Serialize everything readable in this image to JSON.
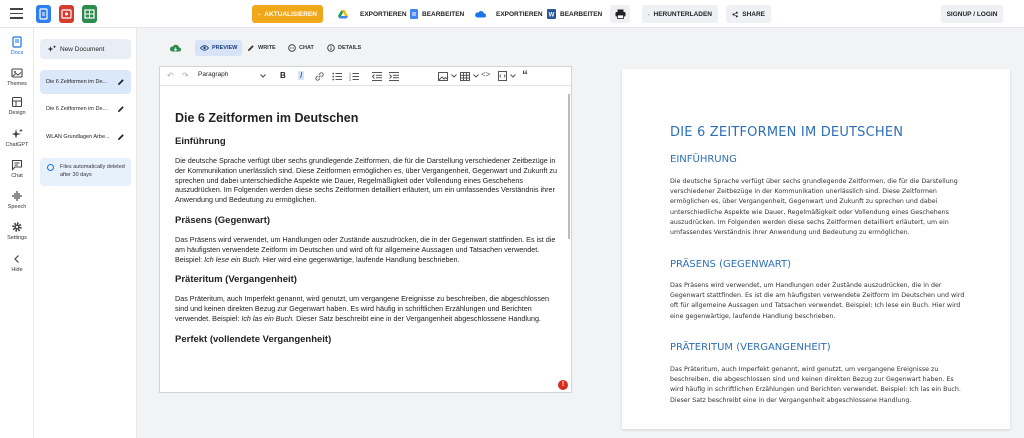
{
  "topbar": {
    "aktualisieren": "AKTUALISIEREN",
    "exportieren1": "EXPORTIEREN",
    "bearbeiten1": "BEARBEITEN",
    "exportieren2": "EXPORTIEREN",
    "bearbeiten2": "BEARBEITEN",
    "herunterladen": "HERUNTERLADEN",
    "share": "SHARE",
    "signup": "SIGNUP / LOGIN"
  },
  "rail": {
    "docs": "Docs",
    "themes": "Themes",
    "design": "Design",
    "chatgpt": "ChatGPT",
    "chat": "Chat",
    "speech": "Speech",
    "settings": "Settings",
    "hide": "Hide"
  },
  "docs_panel": {
    "new_doc": "New Document",
    "items": [
      "Die 6 Zeitformen im De...",
      "Die 6 Zeitformen im De...",
      "WLAN Grundlagen Arbe..."
    ],
    "info": "Files automatically deleted after 30 days"
  },
  "modes": {
    "preview": "PREVIEW",
    "write": "WRITE",
    "chat": "CHAT",
    "details": "DETAILS"
  },
  "editor": {
    "paragraph_select": "Paragraph",
    "title": "Die 6 Zeitformen im Deutschen",
    "h_einfuehrung": "Einführung",
    "p_einfuehrung": "Die deutsche Sprache verfügt über sechs grundlegende Zeitformen, die für die Darstellung verschiedener Zeitbezüge in der Kommunikation unerlässlich sind. Diese Zeitformen ermöglichen es, über Vergangenheit, Gegenwart und Zukunft zu sprechen und dabei unterschiedliche Aspekte wie Dauer, Regelmäßigkeit oder Vollendung eines Geschehens auszudrücken. Im Folgenden werden diese sechs Zeitformen detailliert erläutert, um ein umfassendes Verständnis ihrer Anwendung und Bedeutung zu ermöglichen.",
    "h_praesens": "Präsens (Gegenwart)",
    "p_praesens_a": "Das Präsens wird verwendet, um Handlungen oder Zustände auszudrücken, die in der Gegenwart stattfinden. Es ist die am häufigsten verwendete Zeitform im Deutschen und wird oft für allgemeine Aussagen und Tatsachen verwendet. Beispiel: ",
    "p_praesens_ex": "Ich lese ein Buch.",
    "p_praesens_b": " Hier wird eine gegenwärtige, laufende Handlung beschrieben.",
    "h_praeteritum": "Präteritum (Vergangenheit)",
    "p_praeteritum_a": "Das Präteritum, auch Imperfekt genannt, wird genutzt, um vergangene Ereignisse zu beschreiben, die abgeschlossen sind und keinen direkten Bezug zur Gegenwart haben. Es wird häufig in schriftlichen Erzählungen und Berichten verwendet. Beispiel: ",
    "p_praeteritum_ex": "Ich las ein Buch.",
    "p_praeteritum_b": " Dieser Satz beschreibt eine in der Vergangenheit abgeschlossene Handlung.",
    "h_perfekt": "Perfekt (vollendete Vergangenheit)"
  },
  "preview": {
    "title": "DIE 6 ZEITFORMEN IM DEUTSCHEN",
    "h_einfuehrung": "EINFÜHRUNG",
    "p_einfuehrung": "Die deutsche Sprache verfügt über sechs grundlegende Zeitformen, die für die Darstellung verschiedener Zeitbezüge in der Kommunikation unerlässlich sind. Diese Zeitformen ermöglichen es, über Vergangenheit, Gegenwart und Zukunft zu sprechen und dabei unterschiedliche Aspekte wie Dauer, Regelmäßigkeit oder Vollendung eines Geschehens auszudrücken. Im Folgenden werden diese sechs Zeitformen detailliert erläutert, um ein umfassendes Verständnis ihrer Anwendung und Bedeutung zu ermöglichen.",
    "h_praesens": "PRÄSENS (GEGENWART)",
    "p_praesens": "Das Präsens wird verwendet, um Handlungen oder Zustände auszudrücken, die in der Gegenwart stattfinden. Es ist die am häufigsten verwendete Zeitform im Deutschen und wird oft für allgemeine Aussagen und Tatsachen verwendet. Beispiel: Ich lese ein Buch. Hier wird eine gegenwärtige, laufende Handlung beschrieben.",
    "h_praeteritum": "PRÄTERITUM (VERGANGENHEIT)",
    "p_praeteritum": "Das Präteritum, auch Imperfekt genannt, wird genutzt, um vergangene Ereignisse zu beschreiben, die abgeschlossen sind und keinen direkten Bezug zur Gegenwart haben. Es wird häufig in schriftlichen Erzählungen und Berichten verwendet. Beispiel: Ich las ein Buch. Dieser Satz beschreibt eine in der Vergangenheit abgeschlossene Handlung."
  },
  "colors": {
    "accent": "#1a73e8",
    "aktualisieren_bg": "#f0a81a",
    "preview_heading": "#2e6fb7",
    "error": "#d92d20"
  }
}
